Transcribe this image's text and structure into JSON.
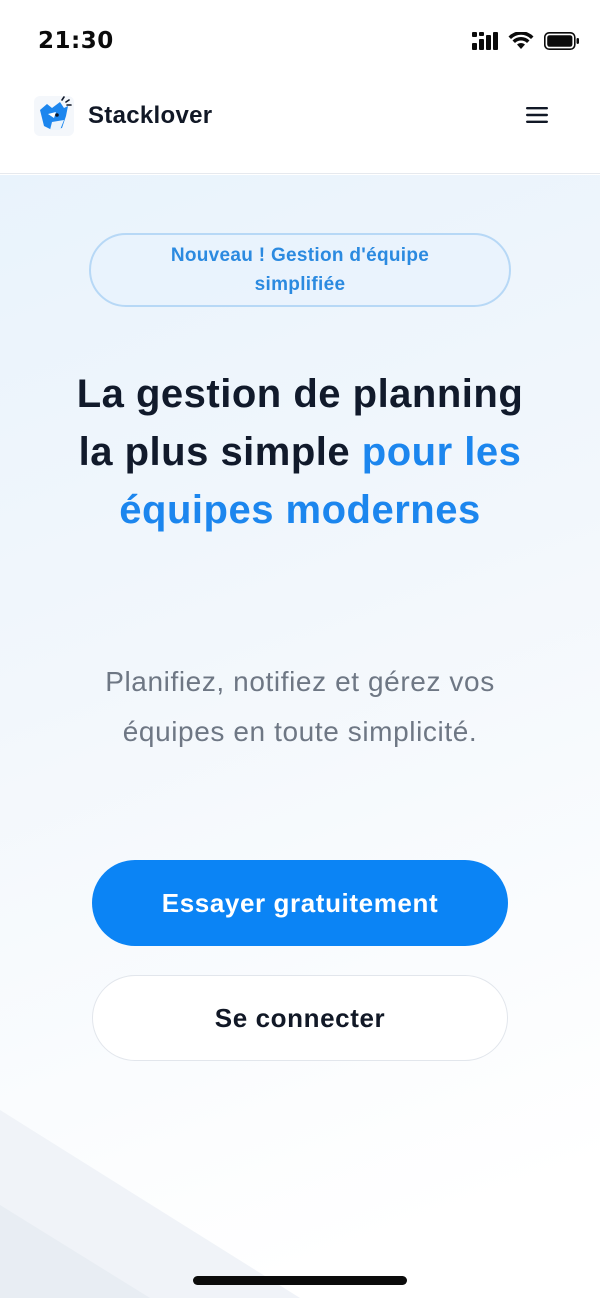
{
  "status_bar": {
    "time": "21:30",
    "icons": [
      "signal-icon",
      "wifi-icon",
      "battery-icon"
    ]
  },
  "header": {
    "brand": "Stacklover",
    "logo_icon": "fox-logo-icon",
    "menu_icon": "hamburger-menu-icon"
  },
  "hero": {
    "badge": "Nouveau ! Gestion d'équipe simplifiée",
    "title_part1": "La gestion de planning la plus simple ",
    "title_accent": "pour les équipes modernes",
    "subtitle": "Planifiez, notifiez et gérez vos équipes en toute simplicité.",
    "primary_cta": "Essayer gratuitement",
    "secondary_cta": "Se connecter"
  },
  "colors": {
    "accent": "#1c86ee",
    "primary_button": "#0b84f5",
    "text_dark": "#111a2b",
    "text_muted": "#6e7784"
  }
}
